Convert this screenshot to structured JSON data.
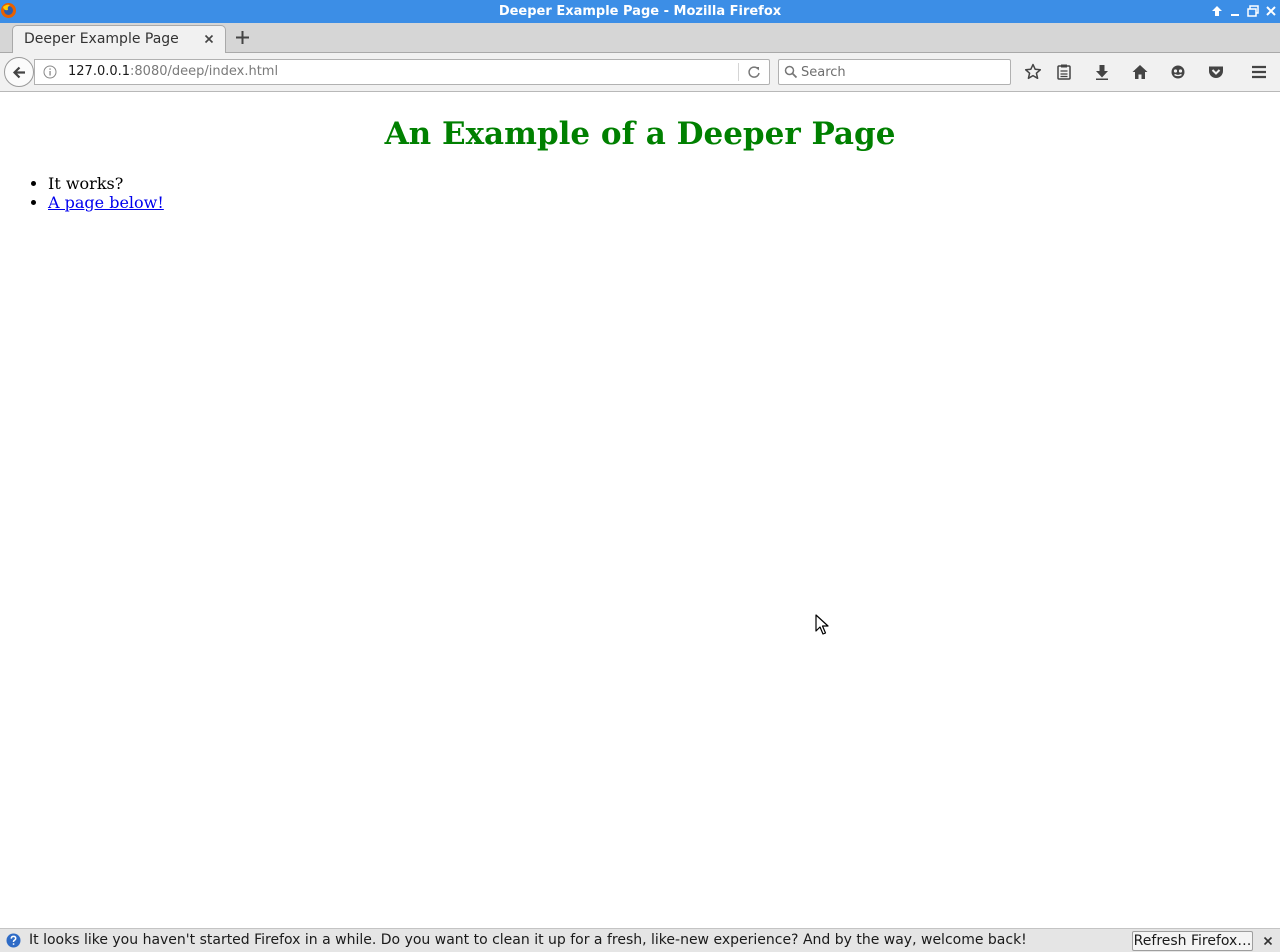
{
  "window": {
    "title": "Deeper Example Page - Mozilla Firefox",
    "title_bar_color": "#3c8ee6"
  },
  "tabs": [
    {
      "label": "Deeper Example Page",
      "active": true
    }
  ],
  "navbar": {
    "url_host": "127.0.0.1",
    "url_rest": ":8080/deep/index.html",
    "search_placeholder": "Search"
  },
  "page": {
    "heading": "An Example of a Deeper Page",
    "heading_color": "#008000",
    "items": [
      {
        "text": "It works?",
        "is_link": false
      },
      {
        "text": "A page below!",
        "is_link": true
      }
    ]
  },
  "notification": {
    "message": "It looks like you haven't started Firefox in a while. Do you want to clean it up for a fresh, like-new experience? And by the way, welcome back!",
    "button_label": "Refresh Firefox…"
  },
  "icons": {
    "toolbar": [
      "bookmark-star-icon",
      "reading-list-icon",
      "download-icon",
      "home-icon",
      "sync-icon",
      "pocket-icon",
      "menu-icon"
    ]
  }
}
